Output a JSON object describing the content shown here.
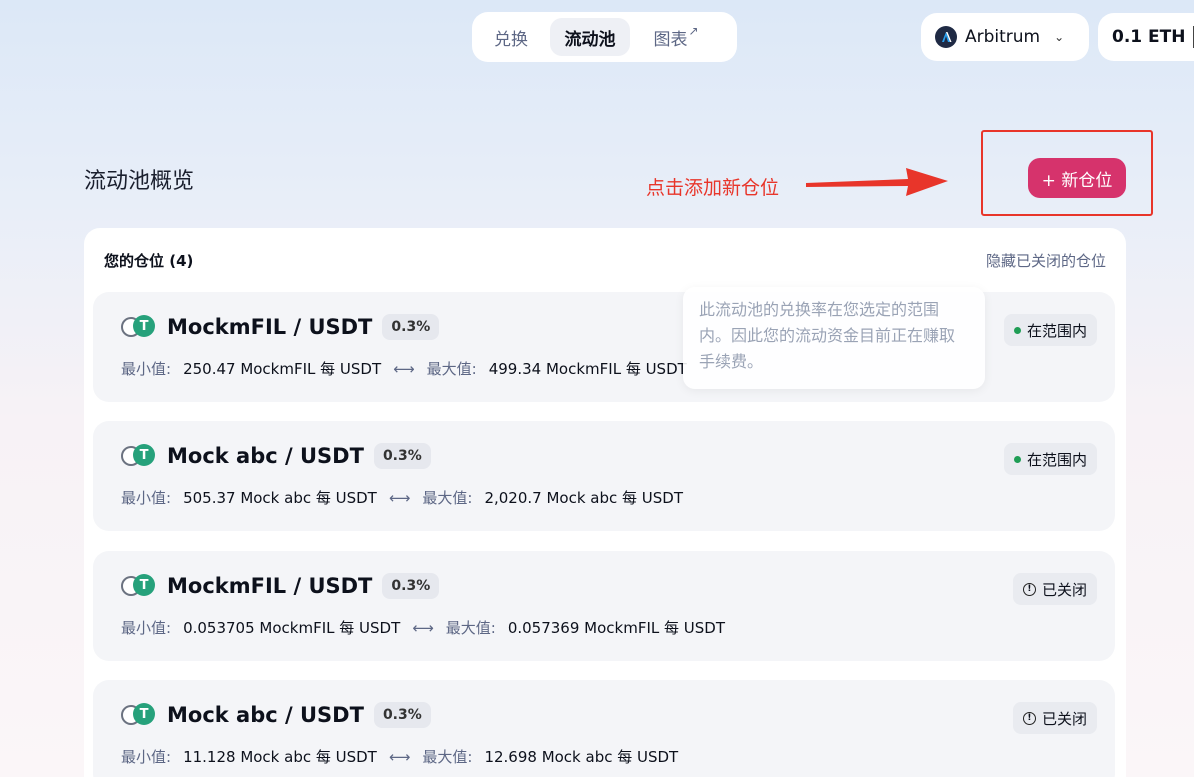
{
  "nav": {
    "tabs": [
      {
        "label": "兑换",
        "active": false
      },
      {
        "label": "流动池",
        "active": true
      },
      {
        "label": "图表",
        "arrow": "↗",
        "active": false
      }
    ],
    "network": {
      "name": "Arbitrum",
      "icon": "arbitrum-logo"
    },
    "balance": "0.1 ETH"
  },
  "header": {
    "title": "流动池概览",
    "annotation": "点击添加新仓位",
    "new_position_label": "+ 新仓位"
  },
  "panel": {
    "title": "您的仓位 (4)",
    "hide_closed": "隐藏已关闭的仓位",
    "min_label": "最小值:",
    "max_label": "最大值:",
    "swap_symbol": "⟷",
    "positions": [
      {
        "pair": "MockmFIL / USDT",
        "fee": "0.3%",
        "min": "250.47 MockmFIL 每 USDT",
        "max": "499.34 MockmFIL 每 USDT",
        "status": "在范围内",
        "status_type": "in-range"
      },
      {
        "pair": "Mock abc / USDT",
        "fee": "0.3%",
        "min": "505.37 Mock abc 每 USDT",
        "max": "2,020.7 Mock abc 每 USDT",
        "status": "在范围内",
        "status_type": "in-range"
      },
      {
        "pair": "MockmFIL / USDT",
        "fee": "0.3%",
        "min": "0.053705 MockmFIL 每 USDT",
        "max": "0.057369 MockmFIL 每 USDT",
        "status": "已关闭",
        "status_type": "closed"
      },
      {
        "pair": "Mock abc / USDT",
        "fee": "0.3%",
        "min": "11.128 Mock abc 每 USDT",
        "max": "12.698 Mock abc 每 USDT",
        "status": "已关闭",
        "status_type": "closed"
      }
    ]
  },
  "tooltip": {
    "text": "此流动池的兑换率在您选定的范围内。因此您的流动资金目前正在赚取手续费。"
  },
  "colors": {
    "accent": "#d6336c",
    "annotation_red": "#e8352a",
    "in_range_dot": "#1f9d55"
  }
}
